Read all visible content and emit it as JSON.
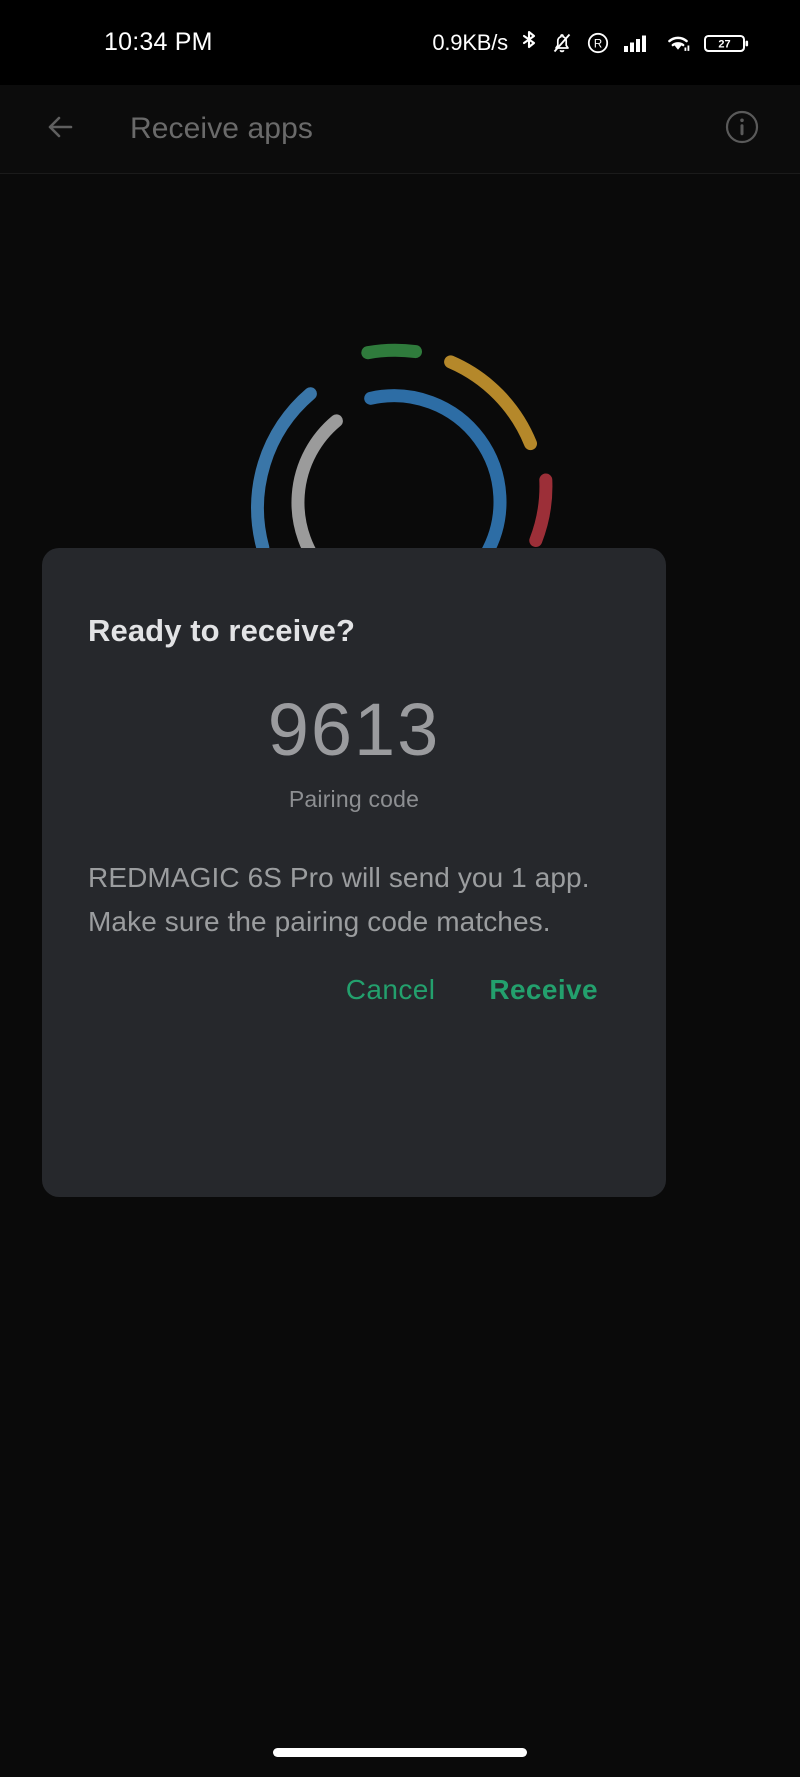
{
  "status_bar": {
    "time": "10:34 PM",
    "network_speed": "0.9KB/s",
    "battery_level": "27",
    "icons": [
      "bluetooth-icon",
      "notifications-muted-icon",
      "r-badge-icon",
      "cellular-signal-icon",
      "wifi-icon",
      "battery-icon"
    ]
  },
  "app_bar": {
    "title": "Receive apps",
    "back_icon": "arrow-back-icon",
    "info_icon": "info-circle-icon"
  },
  "spinner": {
    "name": "loading-spinner",
    "outer_arcs": [
      {
        "color": "#3a76a8",
        "name": "blue-arc"
      },
      {
        "color": "#2f7b3c",
        "name": "green-arc"
      },
      {
        "color": "#b5882a",
        "name": "amber-arc"
      },
      {
        "color": "#9c2f38",
        "name": "red-arc"
      }
    ],
    "inner_arcs": [
      {
        "color": "#9b9b9b",
        "name": "grey-arc"
      },
      {
        "color": "#2d6da5",
        "name": "blue-arc"
      }
    ]
  },
  "dialog": {
    "title": "Ready to receive?",
    "pairing_code": "9613",
    "pairing_code_label": "Pairing code",
    "body_line_1": "REDMAGIC 6S Pro will send you 1 app.",
    "body_line_2": "Make sure the pairing code matches.",
    "cancel_label": "Cancel",
    "confirm_label": "Receive",
    "accent_color": "#23a06d",
    "surface_color": "#26282c"
  },
  "navigation": {
    "gesture_pill": "home-gesture-pill"
  }
}
